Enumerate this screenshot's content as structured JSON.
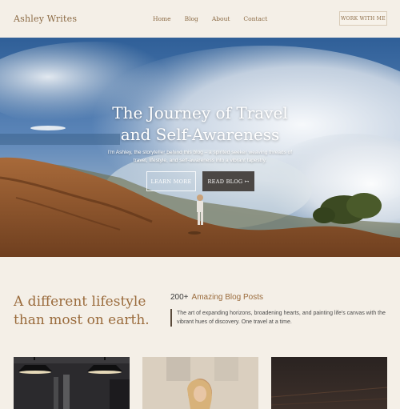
{
  "header": {
    "logo": "Ashley Writes",
    "nav": [
      "Home",
      "Blog",
      "About",
      "Contact"
    ],
    "cta": "WORK WITH ME"
  },
  "hero": {
    "title_line1": "The Journey of Travel",
    "title_line2": "and Self-Awareness",
    "subtitle": "I'm Ashley, the storyteller behind this blog – a spirited seeker weaving threads of travel, lifestyle, and self-awareness into a vibrant tapestry.",
    "learn_more": "LEARN MORE",
    "read_blog": "READ BLOG ↦"
  },
  "intro": {
    "heading": "A different lifestyle than most on earth.",
    "stat_number": "200+",
    "stat_label": "Amazing Blog Posts",
    "quote": "The art of expanding horizons, broadening hearts, and painting life's canvas with the vibrant hues of discovery. One travel at a time."
  }
}
